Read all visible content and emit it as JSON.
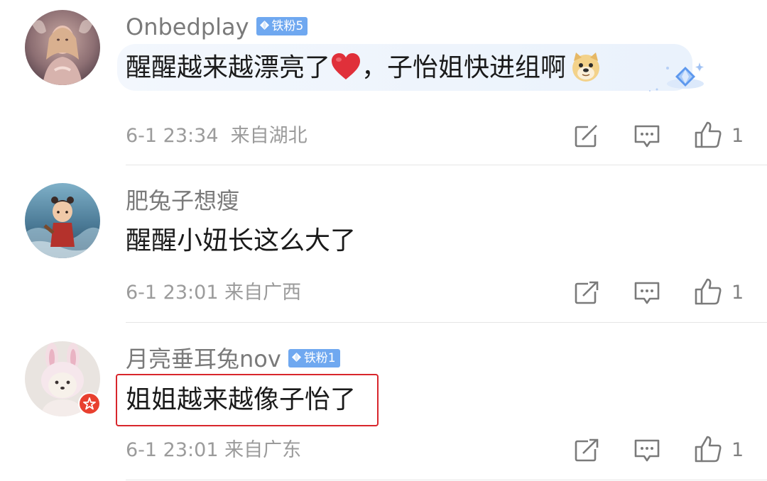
{
  "colors": {
    "username": "#7a7a7a",
    "content": "#1a1a1a",
    "meta": "#9b9b9b",
    "badge": "#6fa8f0",
    "highlight": "#d8262c",
    "heart": "#e0303a"
  },
  "comments": [
    {
      "username": "Onbedplay",
      "badge": "铁粉5",
      "content_before": "醒醒越来越漂亮了",
      "content_after": "，子怡姐快进组啊",
      "time": "6-1 23:34",
      "location": "来自湖北",
      "likes": "1"
    },
    {
      "username": "肥兔子想瘦",
      "content": "醒醒小妞长这么大了",
      "time": "6-1 23:01",
      "location": "来自广西",
      "likes": "1"
    },
    {
      "username": "月亮垂耳兔nov",
      "badge": "铁粉1",
      "content": "姐姐越来越像子怡了",
      "time": "6-1 23:01",
      "location": "来自广东",
      "likes": "1"
    }
  ],
  "icons": {
    "repost": "repost-icon",
    "comment": "comment-icon",
    "like": "thumbs-up-icon",
    "heart": "heart-emoji",
    "doge": "doge-emoji",
    "badge": "diamond-icon"
  }
}
